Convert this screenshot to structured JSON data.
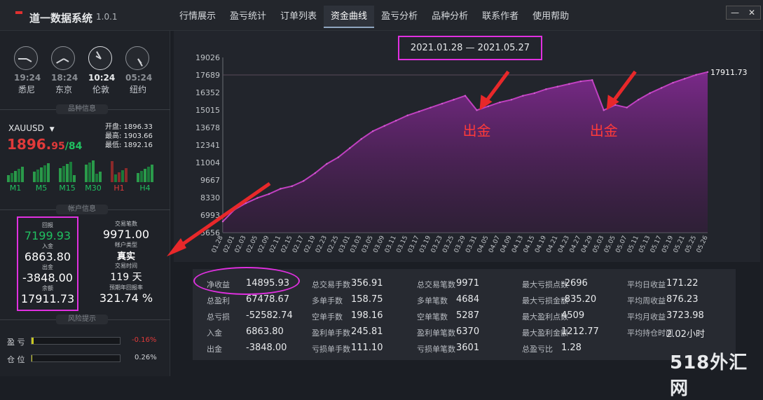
{
  "app": {
    "title": "道一数据系统",
    "version": "1.0.1",
    "logo": "道一"
  },
  "nav": [
    "行情展示",
    "盈亏统计",
    "订单列表",
    "资金曲线",
    "盈亏分析",
    "品种分析",
    "联系作者",
    "使用帮助"
  ],
  "active_tab": "资金曲线",
  "clocks": [
    {
      "time": "19:24",
      "city": "悉尼"
    },
    {
      "time": "18:24",
      "city": "东京"
    },
    {
      "time": "10:24",
      "city": "伦敦"
    },
    {
      "time": "05:24",
      "city": "纽约"
    }
  ],
  "instrument": {
    "section": "品种信息",
    "symbol": "XAUUSD",
    "price_main": "1896.",
    "price_frac": "95",
    "price_alt": "/84",
    "open": "开盘: 1896.33",
    "high": "最高: 1903.66",
    "low": "最低: 1892.16",
    "timeframes": [
      "M1",
      "M5",
      "M15",
      "M30",
      "H1",
      "H4"
    ]
  },
  "account": {
    "section": "帐户信息",
    "profit_label": "回报",
    "profit": "7199.93",
    "deposit_label": "入金",
    "deposit": "6863.80",
    "withdraw_label": "出金",
    "withdraw": "-3848.00",
    "balance_label": "余额",
    "balance": "17911.73",
    "trades_label": "交易笔数",
    "trades": "9971.00",
    "type_label": "帐户类型",
    "type": "真实",
    "days_label": "交易时间",
    "days": "119 天",
    "annual_label": "预期年回报率",
    "annual": "321.74 %"
  },
  "risk": {
    "section": "风险提示",
    "pl_label": "盈 亏",
    "pl_value": "-0.16%",
    "pl_level": 0.02,
    "pos_label": "仓 位",
    "pos_value": "0.26%",
    "pos_level": 0.01
  },
  "chart_data": {
    "type": "area",
    "date_range": "2021.01.28 — 2021.05.27",
    "last_value_label": "17911.73",
    "y_ticks": [
      "19026",
      "17689",
      "16352",
      "15015",
      "13678",
      "12341",
      "11004",
      "9667",
      "8330",
      "6993",
      "5656"
    ],
    "ylim": [
      5656,
      19026
    ],
    "x": [
      "01.28",
      "02.01",
      "02.03",
      "02.05",
      "02.09",
      "02.11",
      "02.15",
      "02.17",
      "02.19",
      "02.23",
      "02.25",
      "03.01",
      "03.03",
      "03.05",
      "03.09",
      "03.11",
      "03.15",
      "03.17",
      "03.19",
      "03.23",
      "03.25",
      "03.29",
      "03.31",
      "04.05",
      "04.07",
      "04.09",
      "04.13",
      "04.15",
      "04.19",
      "04.21",
      "04.23",
      "04.27",
      "04.29",
      "05.03",
      "05.05",
      "05.07",
      "05.11",
      "05.13",
      "05.17",
      "05.19",
      "05.21",
      "05.25",
      "05.26"
    ],
    "values": [
      6500,
      7400,
      7900,
      8300,
      8600,
      9000,
      9200,
      9600,
      10200,
      10900,
      11400,
      12100,
      12800,
      13400,
      13800,
      14200,
      14600,
      14900,
      15200,
      15500,
      15800,
      16100,
      15000,
      15300,
      15600,
      15800,
      16100,
      16300,
      16600,
      16800,
      17000,
      17200,
      17300,
      15000,
      15400,
      15200,
      15800,
      16300,
      16700,
      17100,
      17400,
      17700,
      17911.73
    ],
    "annotations": [
      "出金",
      "出金"
    ]
  },
  "stats": [
    {
      "label": "净收益",
      "value": "14895.93"
    },
    {
      "label": "总盈利",
      "value": "67478.67"
    },
    {
      "label": "总亏损",
      "value": "-52582.74"
    },
    {
      "label": "入金",
      "value": "6863.80"
    },
    {
      "label": "出金",
      "value": "-3848.00"
    },
    {
      "label": "总交易手数",
      "value": "356.91"
    },
    {
      "label": "多单手数",
      "value": "158.75"
    },
    {
      "label": "空单手数",
      "value": "198.16"
    },
    {
      "label": "盈利单手数",
      "value": "245.81"
    },
    {
      "label": "亏损单手数",
      "value": "111.10"
    },
    {
      "label": "总交易笔数",
      "value": "9971"
    },
    {
      "label": "多单笔数",
      "value": "4684"
    },
    {
      "label": "空单笔数",
      "value": "5287"
    },
    {
      "label": "盈利单笔数",
      "value": "6370"
    },
    {
      "label": "亏损单笔数",
      "value": "3601"
    },
    {
      "label": "最大亏损点数",
      "value": "-2696"
    },
    {
      "label": "最大亏损金额",
      "value": "-835.20"
    },
    {
      "label": "最大盈利点数",
      "value": "4509"
    },
    {
      "label": "最大盈利金额",
      "value": "1212.77"
    },
    {
      "label": "总盈亏比",
      "value": "1.28"
    },
    {
      "label": "平均日收益",
      "value": "171.22"
    },
    {
      "label": "平均周收益",
      "value": "876.23"
    },
    {
      "label": "平均月收益",
      "value": "3723.98"
    },
    {
      "label": "平均持仓时间",
      "value": "2.02小时"
    }
  ],
  "watermark": "518外汇网"
}
